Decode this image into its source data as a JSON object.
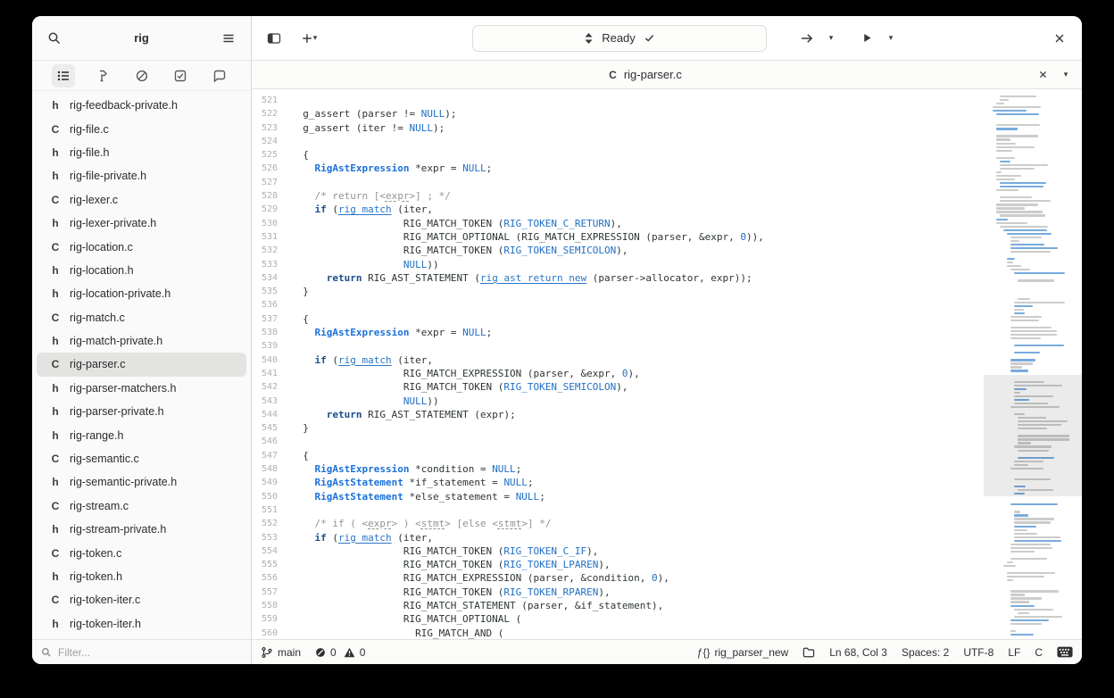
{
  "sidebar": {
    "title": "rig",
    "filter_placeholder": "Filter...",
    "tabs": [
      "project-tree",
      "build",
      "errors",
      "todo",
      "chat"
    ],
    "files": [
      {
        "icon": "h",
        "name": "rig-feedback-private.h",
        "selected": false
      },
      {
        "icon": "C",
        "name": "rig-file.c",
        "selected": false
      },
      {
        "icon": "h",
        "name": "rig-file.h",
        "selected": false
      },
      {
        "icon": "h",
        "name": "rig-file-private.h",
        "selected": false
      },
      {
        "icon": "C",
        "name": "rig-lexer.c",
        "selected": false
      },
      {
        "icon": "h",
        "name": "rig-lexer-private.h",
        "selected": false
      },
      {
        "icon": "C",
        "name": "rig-location.c",
        "selected": false
      },
      {
        "icon": "h",
        "name": "rig-location.h",
        "selected": false
      },
      {
        "icon": "h",
        "name": "rig-location-private.h",
        "selected": false
      },
      {
        "icon": "C",
        "name": "rig-match.c",
        "selected": false
      },
      {
        "icon": "h",
        "name": "rig-match-private.h",
        "selected": false
      },
      {
        "icon": "C",
        "name": "rig-parser.c",
        "selected": true
      },
      {
        "icon": "h",
        "name": "rig-parser-matchers.h",
        "selected": false
      },
      {
        "icon": "h",
        "name": "rig-parser-private.h",
        "selected": false
      },
      {
        "icon": "h",
        "name": "rig-range.h",
        "selected": false
      },
      {
        "icon": "C",
        "name": "rig-semantic.c",
        "selected": false
      },
      {
        "icon": "h",
        "name": "rig-semantic-private.h",
        "selected": false
      },
      {
        "icon": "C",
        "name": "rig-stream.c",
        "selected": false
      },
      {
        "icon": "h",
        "name": "rig-stream-private.h",
        "selected": false
      },
      {
        "icon": "C",
        "name": "rig-token.c",
        "selected": false
      },
      {
        "icon": "h",
        "name": "rig-token.h",
        "selected": false
      },
      {
        "icon": "C",
        "name": "rig-token-iter.c",
        "selected": false
      },
      {
        "icon": "h",
        "name": "rig-token-iter.h",
        "selected": false
      }
    ]
  },
  "header": {
    "status_text": "Ready"
  },
  "tab": {
    "lang_icon": "C",
    "label": "rig-parser.c"
  },
  "editor": {
    "lines": [
      {
        "n": 521,
        "s": []
      },
      {
        "n": 522,
        "s": [
          [
            "  g_assert (parser != ",
            "p"
          ],
          [
            "NULL",
            "c"
          ],
          [
            ");",
            "p"
          ]
        ]
      },
      {
        "n": 523,
        "s": [
          [
            "  g_assert (iter != ",
            "p"
          ],
          [
            "NULL",
            "c"
          ],
          [
            ");",
            "p"
          ]
        ]
      },
      {
        "n": 524,
        "s": []
      },
      {
        "n": 525,
        "s": [
          [
            "  {",
            "p"
          ]
        ]
      },
      {
        "n": 526,
        "s": [
          [
            "    ",
            "p"
          ],
          [
            "RigAstExpression",
            "t"
          ],
          [
            " *expr = ",
            "p"
          ],
          [
            "NULL",
            "c"
          ],
          [
            ";",
            "p"
          ]
        ]
      },
      {
        "n": 527,
        "s": []
      },
      {
        "n": 528,
        "s": [
          [
            "    ",
            "p"
          ],
          [
            "/* return [<",
            "m"
          ],
          [
            "expr",
            "mu"
          ],
          [
            ">] ; */",
            "m"
          ]
        ]
      },
      {
        "n": 529,
        "s": [
          [
            "    ",
            "p"
          ],
          [
            "if",
            "k"
          ],
          [
            " (",
            "p"
          ],
          [
            "rig_match",
            "f"
          ],
          [
            " (iter,",
            "p"
          ]
        ]
      },
      {
        "n": 530,
        "s": [
          [
            "                   RIG_MATCH_TOKEN (",
            "p"
          ],
          [
            "RIG_TOKEN_C_RETURN",
            "c"
          ],
          [
            "),",
            "p"
          ]
        ]
      },
      {
        "n": 531,
        "s": [
          [
            "                   RIG_MATCH_OPTIONAL (RIG_MATCH_EXPRESSION (parser, &expr, ",
            "p"
          ],
          [
            "0",
            "c"
          ],
          [
            ")),",
            "p"
          ]
        ]
      },
      {
        "n": 532,
        "s": [
          [
            "                   RIG_MATCH_TOKEN (",
            "p"
          ],
          [
            "RIG_TOKEN_SEMICOLON",
            "c"
          ],
          [
            "),",
            "p"
          ]
        ]
      },
      {
        "n": 533,
        "s": [
          [
            "                   ",
            "p"
          ],
          [
            "NULL",
            "c"
          ],
          [
            "))",
            "p"
          ]
        ]
      },
      {
        "n": 534,
        "s": [
          [
            "      ",
            "p"
          ],
          [
            "return",
            "k"
          ],
          [
            " RIG_AST_STATEMENT (",
            "p"
          ],
          [
            "rig_ast_return_new",
            "f"
          ],
          [
            " (parser->allocator, expr));",
            "p"
          ]
        ]
      },
      {
        "n": 535,
        "s": [
          [
            "  }",
            "p"
          ]
        ]
      },
      {
        "n": 536,
        "s": []
      },
      {
        "n": 537,
        "s": [
          [
            "  {",
            "p"
          ]
        ]
      },
      {
        "n": 538,
        "s": [
          [
            "    ",
            "p"
          ],
          [
            "RigAstExpression",
            "t"
          ],
          [
            " *expr = ",
            "p"
          ],
          [
            "NULL",
            "c"
          ],
          [
            ";",
            "p"
          ]
        ]
      },
      {
        "n": 539,
        "s": []
      },
      {
        "n": 540,
        "s": [
          [
            "    ",
            "p"
          ],
          [
            "if",
            "k"
          ],
          [
            " (",
            "p"
          ],
          [
            "rig_match",
            "f"
          ],
          [
            " (iter,",
            "p"
          ]
        ]
      },
      {
        "n": 541,
        "s": [
          [
            "                   RIG_MATCH_EXPRESSION (parser, &expr, ",
            "p"
          ],
          [
            "0",
            "c"
          ],
          [
            "),",
            "p"
          ]
        ]
      },
      {
        "n": 542,
        "s": [
          [
            "                   RIG_MATCH_TOKEN (",
            "p"
          ],
          [
            "RIG_TOKEN_SEMICOLON",
            "c"
          ],
          [
            "),",
            "p"
          ]
        ]
      },
      {
        "n": 543,
        "s": [
          [
            "                   ",
            "p"
          ],
          [
            "NULL",
            "c"
          ],
          [
            "))",
            "p"
          ]
        ]
      },
      {
        "n": 544,
        "s": [
          [
            "      ",
            "p"
          ],
          [
            "return",
            "k"
          ],
          [
            " RIG_AST_STATEMENT (expr);",
            "p"
          ]
        ]
      },
      {
        "n": 545,
        "s": [
          [
            "  }",
            "p"
          ]
        ]
      },
      {
        "n": 546,
        "s": []
      },
      {
        "n": 547,
        "s": [
          [
            "  {",
            "p"
          ]
        ]
      },
      {
        "n": 548,
        "s": [
          [
            "    ",
            "p"
          ],
          [
            "RigAstExpression",
            "t"
          ],
          [
            " *condition = ",
            "p"
          ],
          [
            "NULL",
            "c"
          ],
          [
            ";",
            "p"
          ]
        ]
      },
      {
        "n": 549,
        "s": [
          [
            "    ",
            "p"
          ],
          [
            "RigAstStatement",
            "t"
          ],
          [
            " *if_statement = ",
            "p"
          ],
          [
            "NULL",
            "c"
          ],
          [
            ";",
            "p"
          ]
        ]
      },
      {
        "n": 550,
        "s": [
          [
            "    ",
            "p"
          ],
          [
            "RigAstStatement",
            "t"
          ],
          [
            " *else_statement = ",
            "p"
          ],
          [
            "NULL",
            "c"
          ],
          [
            ";",
            "p"
          ]
        ]
      },
      {
        "n": 551,
        "s": []
      },
      {
        "n": 552,
        "s": [
          [
            "    ",
            "p"
          ],
          [
            "/* if ( <",
            "m"
          ],
          [
            "expr",
            "mu"
          ],
          [
            "> ) <",
            "m"
          ],
          [
            "stmt",
            "mu"
          ],
          [
            "> [else <",
            "m"
          ],
          [
            "stmt",
            "mu"
          ],
          [
            ">] */",
            "m"
          ]
        ]
      },
      {
        "n": 553,
        "s": [
          [
            "    ",
            "p"
          ],
          [
            "if",
            "k"
          ],
          [
            " (",
            "p"
          ],
          [
            "rig_match",
            "f"
          ],
          [
            " (iter,",
            "p"
          ]
        ]
      },
      {
        "n": 554,
        "s": [
          [
            "                   RIG_MATCH_TOKEN (",
            "p"
          ],
          [
            "RIG_TOKEN_C_IF",
            "c"
          ],
          [
            "),",
            "p"
          ]
        ]
      },
      {
        "n": 555,
        "s": [
          [
            "                   RIG_MATCH_TOKEN (",
            "p"
          ],
          [
            "RIG_TOKEN_LPAREN",
            "c"
          ],
          [
            "),",
            "p"
          ]
        ]
      },
      {
        "n": 556,
        "s": [
          [
            "                   RIG_MATCH_EXPRESSION (parser, &condition, ",
            "p"
          ],
          [
            "0",
            "c"
          ],
          [
            "),",
            "p"
          ]
        ]
      },
      {
        "n": 557,
        "s": [
          [
            "                   RIG_MATCH_TOKEN (",
            "p"
          ],
          [
            "RIG_TOKEN_RPAREN",
            "c"
          ],
          [
            "),",
            "p"
          ]
        ]
      },
      {
        "n": 558,
        "s": [
          [
            "                   RIG_MATCH_STATEMENT (parser, &if_statement),",
            "p"
          ]
        ]
      },
      {
        "n": 559,
        "s": [
          [
            "                   RIG_MATCH_OPTIONAL (",
            "p"
          ]
        ]
      },
      {
        "n": 560,
        "s": [
          [
            "                     RIG_MATCH_AND (",
            "p"
          ]
        ]
      }
    ]
  },
  "statusbar": {
    "branch": "main",
    "errors": "0",
    "warnings": "0",
    "symbol": "rig_parser_new",
    "position": "Ln 68, Col 3",
    "spaces": "Spaces: 2",
    "encoding": "UTF-8",
    "line_ending": "LF",
    "language": "C"
  },
  "colors": {
    "keyword": "#1a4e8c",
    "type": "#1c71d8",
    "constant": "#1f6fc4",
    "function_link": "#2a76c6",
    "comment": "#92948f",
    "selection_row": "#e3e3e1",
    "minimap_viewport": "rgba(0,0,0,0.08)"
  }
}
